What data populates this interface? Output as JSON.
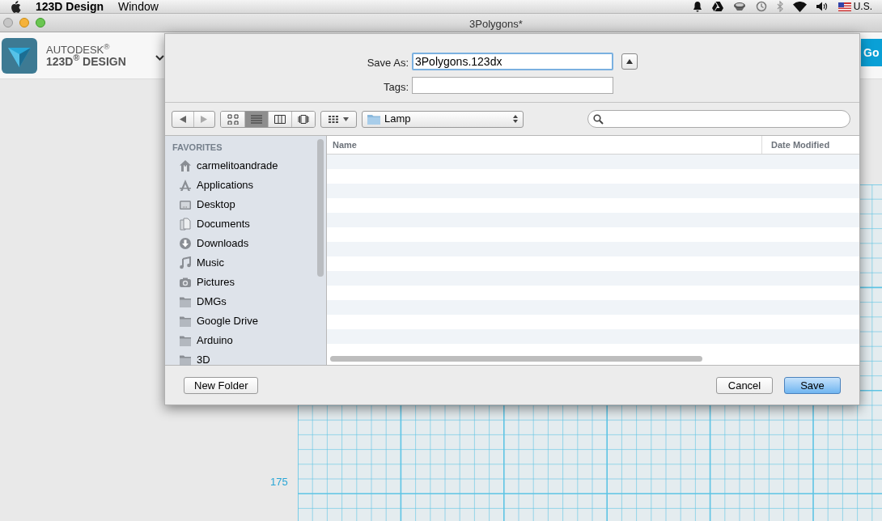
{
  "menu_bar": {
    "app_name": "123D Design",
    "menus": [
      "Window"
    ],
    "input_source": "U.S."
  },
  "window": {
    "title": "3Polygons*"
  },
  "app_toolbar": {
    "brand_top": "AUTODESK$^{®}$",
    "brand_bottom": "123D$^{®}$ DESIGN",
    "go_button": "Go"
  },
  "canvas": {
    "axis_label": "175"
  },
  "save_dialog": {
    "save_as_label": "Save As:",
    "save_as_value": "3Polygons.123dx",
    "tags_label": "Tags:",
    "view_modes": [
      {
        "kind": "icons",
        "selected": false
      },
      {
        "kind": "list",
        "selected": true
      },
      {
        "kind": "columns",
        "selected": false
      },
      {
        "kind": "coverflow",
        "selected": false
      }
    ],
    "location": "Lamp",
    "sidebar": {
      "heading": "FAVORITES",
      "items": [
        {
          "label": "carmelitoandrade",
          "kind": "home"
        },
        {
          "label": "Applications",
          "kind": "applications"
        },
        {
          "label": "Desktop",
          "kind": "desktop"
        },
        {
          "label": "Documents",
          "kind": "documents"
        },
        {
          "label": "Downloads",
          "kind": "downloads"
        },
        {
          "label": "Music",
          "kind": "music"
        },
        {
          "label": "Pictures",
          "kind": "pictures"
        },
        {
          "label": "DMGs",
          "kind": "folder"
        },
        {
          "label": "Google Drive",
          "kind": "folder"
        },
        {
          "label": "Arduino",
          "kind": "folder"
        },
        {
          "label": "3D",
          "kind": "folder"
        }
      ]
    },
    "columns": [
      "Name",
      "Date Modified"
    ],
    "buttons": [
      {
        "label": "New Folder",
        "kind": "secondary"
      },
      {
        "label": "Cancel",
        "kind": "secondary"
      },
      {
        "label": "Save",
        "kind": "default"
      }
    ]
  }
}
